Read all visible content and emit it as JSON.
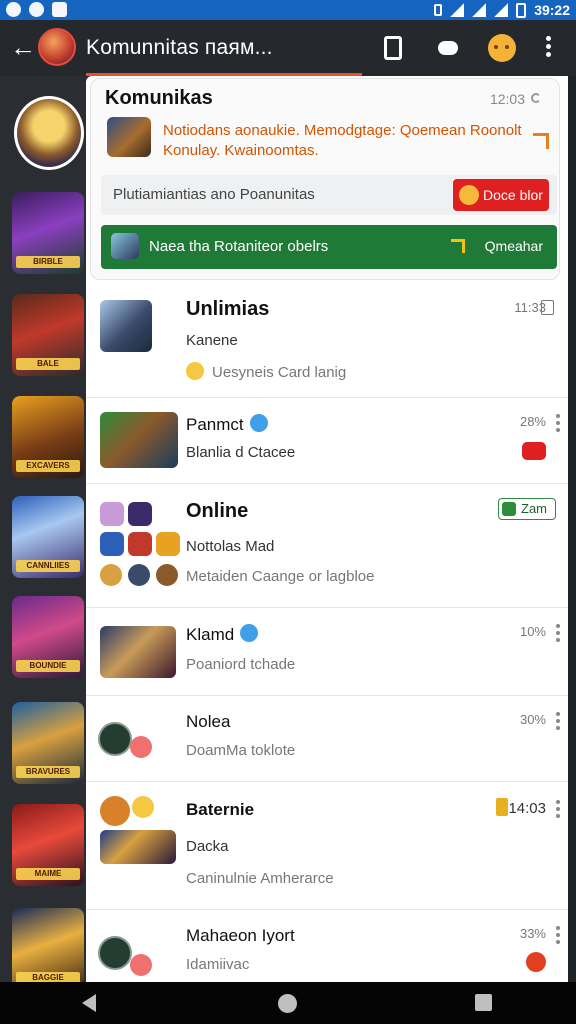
{
  "status_bar": {
    "time": "39:22"
  },
  "app_bar": {
    "title": "Komunnitas паям..."
  },
  "rail": {
    "captions": [
      "BIRBLE",
      "BALE",
      "EXCAVERS",
      "CANNLIIES",
      "BOUNDIE",
      "BRAVURES",
      "MAIME",
      "BAGGIE"
    ]
  },
  "top_card": {
    "title": "Komunikas",
    "time": "12:03",
    "notice": "Notiodans aonaukie. Memodgtage: Qoemean Roonolt Konulay. Kwainoomtas.",
    "search_placeholder": "Plutiamiantias ano Poanunitas",
    "red_button": "Doce blor",
    "green_bar_label": "Naea tha Rotaniteor obelrs",
    "green_bar_action": "Qmeahar"
  },
  "rows": [
    {
      "name": "Unlimias",
      "sub": "Kanene",
      "sub2": "Uesyneis Card lanig",
      "meta": "11:33"
    },
    {
      "name": "Panmct",
      "sub": "Blanlia d Ctacee",
      "meta": "28%"
    },
    {
      "name": "Online",
      "chip": "Zam",
      "sub": "Nottolas Mad",
      "sub2": "Metaiden Caange or lagbloe"
    },
    {
      "name": "Klamd",
      "sub": "Poaniord tchade",
      "meta": "10%"
    },
    {
      "name": "Nolea",
      "sub": "DoamMa toklote",
      "meta": "30%"
    },
    {
      "name": "Baternie",
      "meta": "14:03",
      "sub": "Dacka",
      "sub2": "Caninulnie Amherarce"
    },
    {
      "name": "Mahaeon Iyort",
      "sub": "Idamiivac",
      "meta": "33%"
    }
  ]
}
